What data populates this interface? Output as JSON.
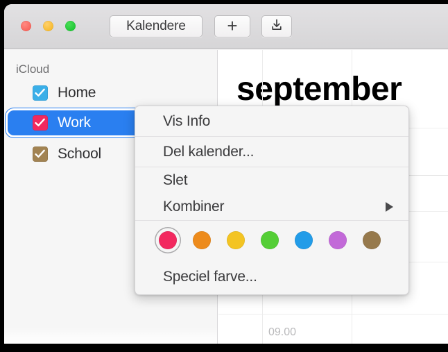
{
  "window": {
    "traffic_lights": [
      {
        "name": "close",
        "color": "#f9655c"
      },
      {
        "name": "minimize",
        "color": "#f7bb31"
      },
      {
        "name": "zoom",
        "color": "#21c836"
      }
    ]
  },
  "toolbar": {
    "calendars_button_label": "Kalendere",
    "add_button_label": "+",
    "add_button_icon": "plus-icon",
    "import_button_icon": "download-tray-icon"
  },
  "sidebar": {
    "group_label": "iCloud",
    "calendars": [
      {
        "name": "Home",
        "color": "#3aafe8",
        "checked": true,
        "selected": false
      },
      {
        "name": "Work",
        "color": "#f2285f",
        "checked": true,
        "selected": true
      },
      {
        "name": "School",
        "color": "#a28352",
        "checked": true,
        "selected": false
      }
    ],
    "selection_color": "#2a7ff0"
  },
  "main": {
    "month_title": "september",
    "time_labels": [
      "09.00"
    ]
  },
  "context_menu": {
    "items": [
      {
        "label": "Vis Info",
        "has_submenu": false
      },
      {
        "label": "Del kalender...",
        "has_submenu": false
      },
      {
        "label": "Slet",
        "has_submenu": false
      },
      {
        "label": "Kombiner",
        "has_submenu": true
      },
      {
        "label": "Speciel farve...",
        "has_submenu": false
      }
    ],
    "submenu_arrow_icon": "triangle-right-icon",
    "colors": [
      {
        "name": "red",
        "hex": "#f2285f",
        "selected": true
      },
      {
        "name": "orange",
        "hex": "#ed8b1c",
        "selected": false
      },
      {
        "name": "yellow",
        "hex": "#f3c423",
        "selected": false
      },
      {
        "name": "green",
        "hex": "#54ce36",
        "selected": false
      },
      {
        "name": "blue",
        "hex": "#229ce8",
        "selected": false
      },
      {
        "name": "purple",
        "hex": "#c269d8",
        "selected": false
      },
      {
        "name": "brown",
        "hex": "#96794c",
        "selected": false
      }
    ]
  }
}
